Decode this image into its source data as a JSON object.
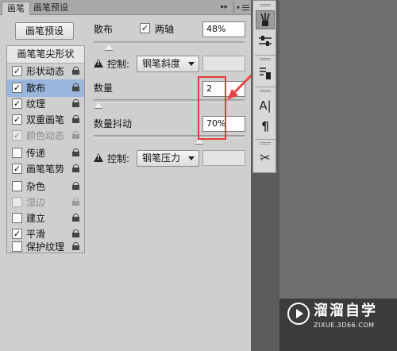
{
  "tabs": [
    {
      "label": "画笔",
      "active": true
    },
    {
      "label": "画笔预设",
      "active": false
    }
  ],
  "panel_controls": {
    "collapse": "▸▸",
    "menu": "menu-icon"
  },
  "brush_presets_button": "画笔预设",
  "brush_tip_shape": "画笔笔尖形状",
  "options": [
    {
      "label": "形状动态",
      "checked": true,
      "enabled": true,
      "selected": false
    },
    {
      "label": "散布",
      "checked": true,
      "enabled": true,
      "selected": true
    },
    {
      "label": "纹理",
      "checked": true,
      "enabled": true,
      "selected": false
    },
    {
      "label": "双重画笔",
      "checked": true,
      "enabled": true,
      "selected": false
    },
    {
      "label": "颜色动态",
      "checked": true,
      "enabled": false,
      "selected": false
    },
    {
      "label": "传递",
      "checked": false,
      "enabled": true,
      "selected": false
    },
    {
      "label": "画笔笔势",
      "checked": true,
      "enabled": true,
      "selected": false
    },
    {
      "label": "杂色",
      "checked": false,
      "enabled": true,
      "selected": false
    },
    {
      "label": "湿边",
      "checked": false,
      "enabled": false,
      "selected": false
    },
    {
      "label": "建立",
      "checked": false,
      "enabled": true,
      "selected": false
    },
    {
      "label": "平滑",
      "checked": true,
      "enabled": true,
      "selected": false
    },
    {
      "label": "保护纹理",
      "checked": false,
      "enabled": true,
      "selected": false
    }
  ],
  "scatter": {
    "label": "散布",
    "both_axes_label": "两轴",
    "both_axes_checked": true,
    "value": "48%",
    "slider_level": 0.1
  },
  "control1": {
    "label": "控制:",
    "value": "钢笔斜度"
  },
  "count": {
    "label": "数量",
    "value": "2",
    "slider_level": 0.03
  },
  "count_jitter": {
    "label": "数量抖动",
    "value": "70%",
    "slider_level": 0.7
  },
  "control2": {
    "label": "控制:",
    "value": "钢笔压力"
  },
  "check_glyph": "✓",
  "toolbar_icons": [
    "brush-icon",
    "sliders-icon",
    "clone-source-icon",
    "character-icon",
    "paragraph-icon",
    "tools-preset-icon"
  ],
  "toolbar_glyphs": {
    "character": "A|",
    "paragraph": "¶",
    "tools": "✂"
  },
  "watermark": {
    "name": "溜溜自学",
    "url": "ZIXUE.3D66.COM"
  },
  "colors": {
    "highlight": "#9ab6dd",
    "annotation": "#e23a3a"
  }
}
